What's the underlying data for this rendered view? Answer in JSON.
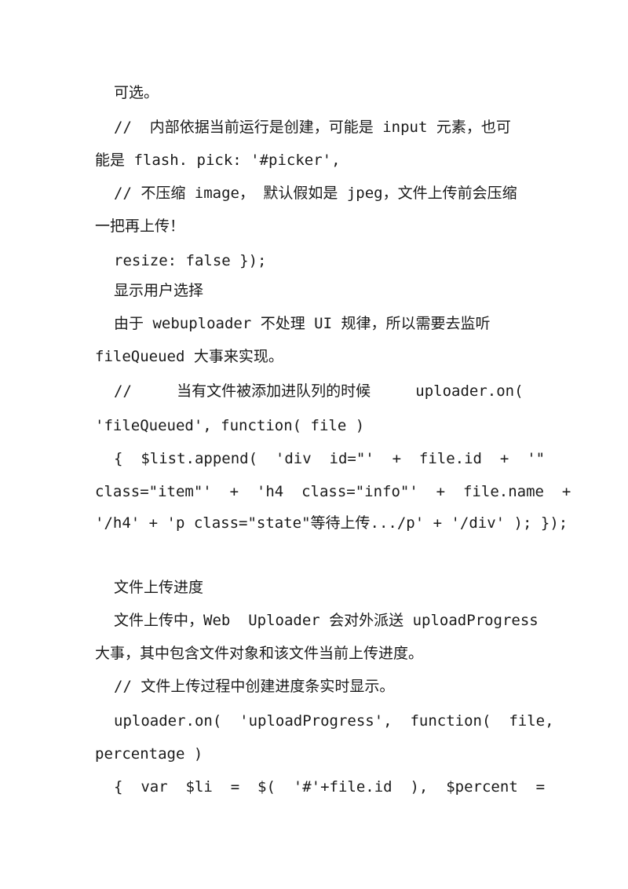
{
  "document": {
    "lines": [
      "可选。",
      "//  内部依据当前运行是创建，可能是 input 元素，也可",
      "能是 flash. pick: '#picker',",
      "// 不压缩 image， 默认假如是 jpeg，文件上传前会压缩",
      "一把再上传！",
      "resize: false });",
      "显示用户选择",
      "由于 webuploader 不处理 UI 规律，所以需要去监听",
      "fileQueued 大事来实现。",
      "//     当有文件被添加进队列的时候     uploader.on(",
      "'fileQueued', function( file )",
      "{  $list.append(  'div  id=\"'  +  file.id  +  '\"",
      "class=\"item\"'  +  'h4  class=\"info\"'  +  file.name  +",
      "'/h4' + 'p class=\"state\"等待上传.../p' + '/div' ); });",
      "文件上传进度",
      "文件上传中，Web  Uploader 会对外派送 uploadProgress",
      "大事，其中包含文件对象和该文件当前上传进度。",
      "// 文件上传过程中创建进度条实时显示。",
      "uploader.on(  'uploadProgress',  function(  file,",
      "percentage )",
      "{  var  $li  =  $(  '#'+file.id  ),  $percent  ="
    ]
  }
}
